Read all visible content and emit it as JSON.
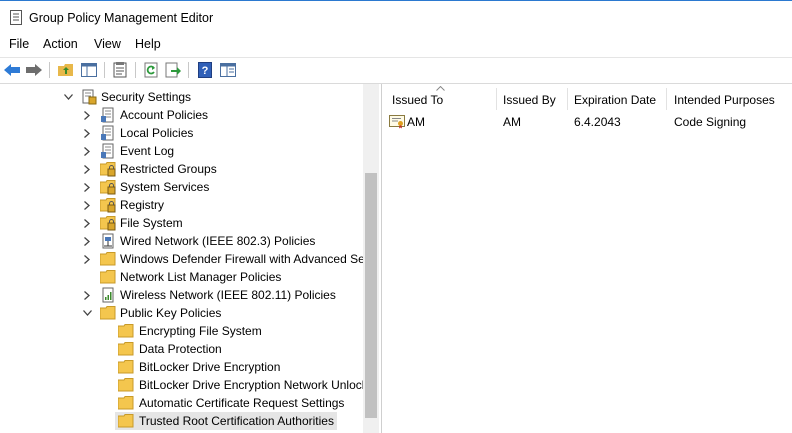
{
  "window": {
    "title": "Group Policy Management Editor"
  },
  "menu": {
    "file": "File",
    "action": "Action",
    "view": "View",
    "help": "Help"
  },
  "toolbar": {
    "buttons": [
      "back-arrow-icon",
      "forward-arrow-icon",
      "up-folder-icon",
      "show-hide-tree-icon",
      "properties-icon",
      "refresh-icon",
      "export-list-icon",
      "help-icon",
      "console-tree-icon"
    ]
  },
  "tree": {
    "security_settings": "Security Settings",
    "account_policies": "Account Policies",
    "local_policies": "Local Policies",
    "event_log": "Event Log",
    "restricted_groups": "Restricted Groups",
    "system_services": "System Services",
    "registry": "Registry",
    "file_system": "File System",
    "wired_network": "Wired Network (IEEE 802.3) Policies",
    "windows_firewall": "Windows Defender Firewall with Advanced Sec",
    "network_list_manager": "Network List Manager Policies",
    "wireless_network": "Wireless Network (IEEE 802.11) Policies",
    "public_key_policies": "Public Key Policies",
    "encrypting_file_system": "Encrypting File System",
    "data_protection": "Data Protection",
    "bitlocker_drive_encryption": "BitLocker Drive Encryption",
    "bitlocker_network_unlock": "BitLocker Drive Encryption Network Unlocl",
    "automatic_cert_request": "Automatic Certificate Request Settings",
    "trusted_root_ca": "Trusted Root Certification Authorities"
  },
  "list": {
    "columns": {
      "issued_to": "Issued To",
      "issued_by": "Issued By",
      "expiration_date": "Expiration Date",
      "intended_purposes": "Intended Purposes"
    },
    "rows": [
      {
        "issued_to": "AM",
        "issued_by": "AM",
        "expiration_date": "6.4.2043",
        "intended_purposes": "Code Signing"
      }
    ]
  },
  "colors": {
    "title_accent": "#2b79d0",
    "folder": "#f4c64e",
    "selection": "#e5e5e5",
    "scroll_thumb": "#c1c1c1"
  }
}
